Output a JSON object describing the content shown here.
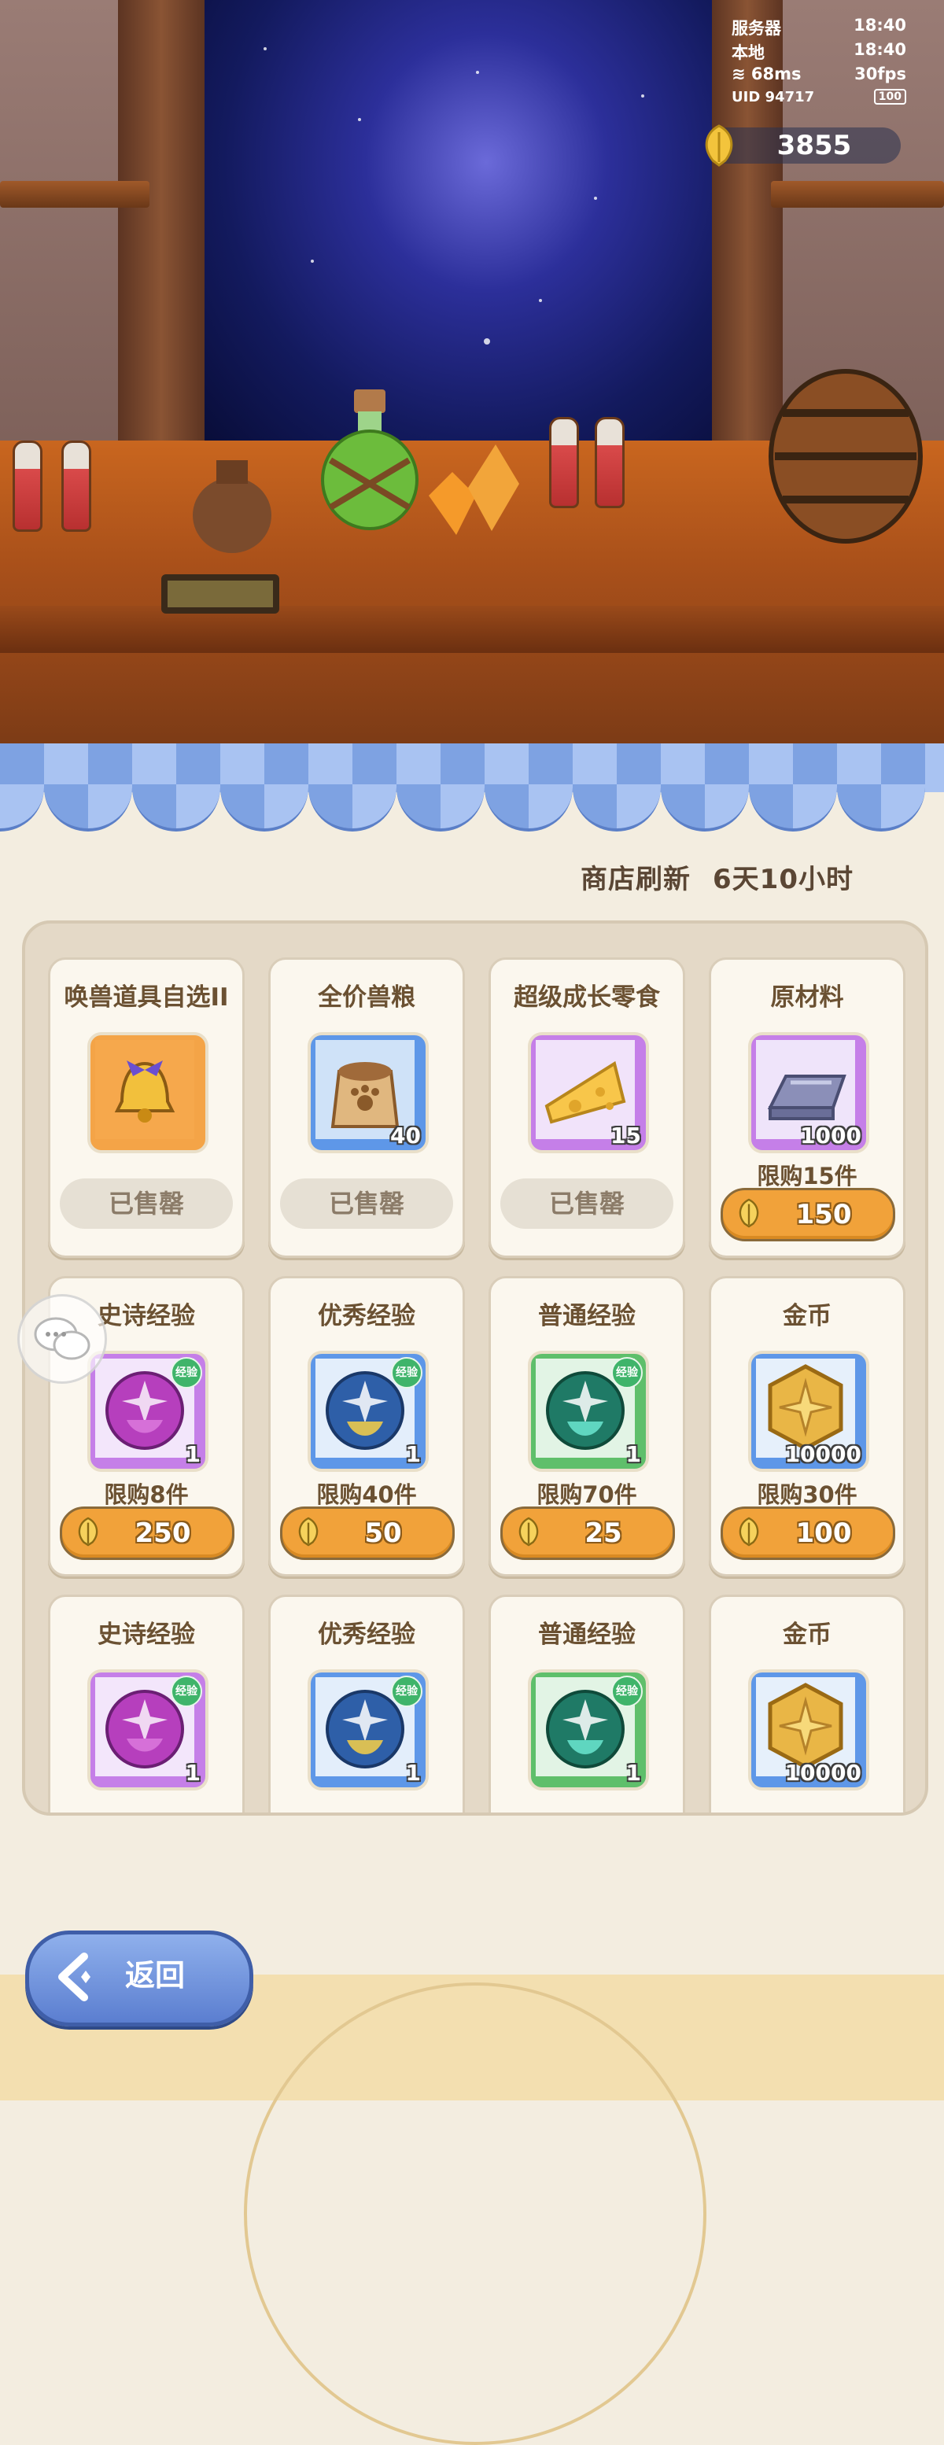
{
  "status": {
    "server_label": "服务器",
    "server_time": "18:40",
    "local_label": "本地",
    "local_time": "18:40",
    "ping": "68ms",
    "fps": "30fps",
    "uid": "UID 94717",
    "battery": "100"
  },
  "currency": {
    "value": "3855",
    "icon": "golden-leaf-icon"
  },
  "shop": {
    "refresh_label": "商店刷新",
    "refresh_time": "6天10小时"
  },
  "items": [
    {
      "title": "唤兽道具自选II",
      "icon": "golden-bell-icon",
      "frame": "orange",
      "qty": "",
      "sold_label": "已售罄"
    },
    {
      "title": "全价兽粮",
      "icon": "food-sack-icon",
      "frame": "blue",
      "qty": "40",
      "sold_label": "已售罄"
    },
    {
      "title": "超级成长零食",
      "icon": "cheese-icon",
      "frame": "purple",
      "qty": "15",
      "sold_label": "已售罄"
    },
    {
      "title": "原材料",
      "icon": "metal-ingot-icon",
      "frame": "purple",
      "qty": "1000",
      "limit": "限购15件",
      "price": "150"
    },
    {
      "title": "史诗经验",
      "icon": "epic-exp-icon",
      "frame": "purple",
      "qty": "1",
      "tag": "经验",
      "limit": "限购8件",
      "price": "250"
    },
    {
      "title": "优秀经验",
      "icon": "good-exp-icon",
      "frame": "blue",
      "qty": "1",
      "tag": "经验",
      "limit": "限购40件",
      "price": "50"
    },
    {
      "title": "普通经验",
      "icon": "common-exp-icon",
      "frame": "green",
      "qty": "1",
      "tag": "经验",
      "limit": "限购70件",
      "price": "25"
    },
    {
      "title": "金币",
      "icon": "gold-coin-icon",
      "frame": "blue",
      "qty": "10000",
      "limit": "限购30件",
      "price": "100"
    },
    {
      "title": "史诗经验",
      "icon": "epic-exp-icon",
      "frame": "purple",
      "qty": "1",
      "tag": "经验"
    },
    {
      "title": "优秀经验",
      "icon": "good-exp-icon",
      "frame": "blue",
      "qty": "1",
      "tag": "经验"
    },
    {
      "title": "普通经验",
      "icon": "common-exp-icon",
      "frame": "green",
      "qty": "1",
      "tag": "经验"
    },
    {
      "title": "金币",
      "icon": "gold-coin-icon",
      "frame": "blue",
      "qty": "10000"
    }
  ],
  "back": {
    "label": "返回"
  },
  "colors": {
    "price": "#f1a23a",
    "awning_blue": "#7ea2e2",
    "panel": "#e4d9c7"
  }
}
